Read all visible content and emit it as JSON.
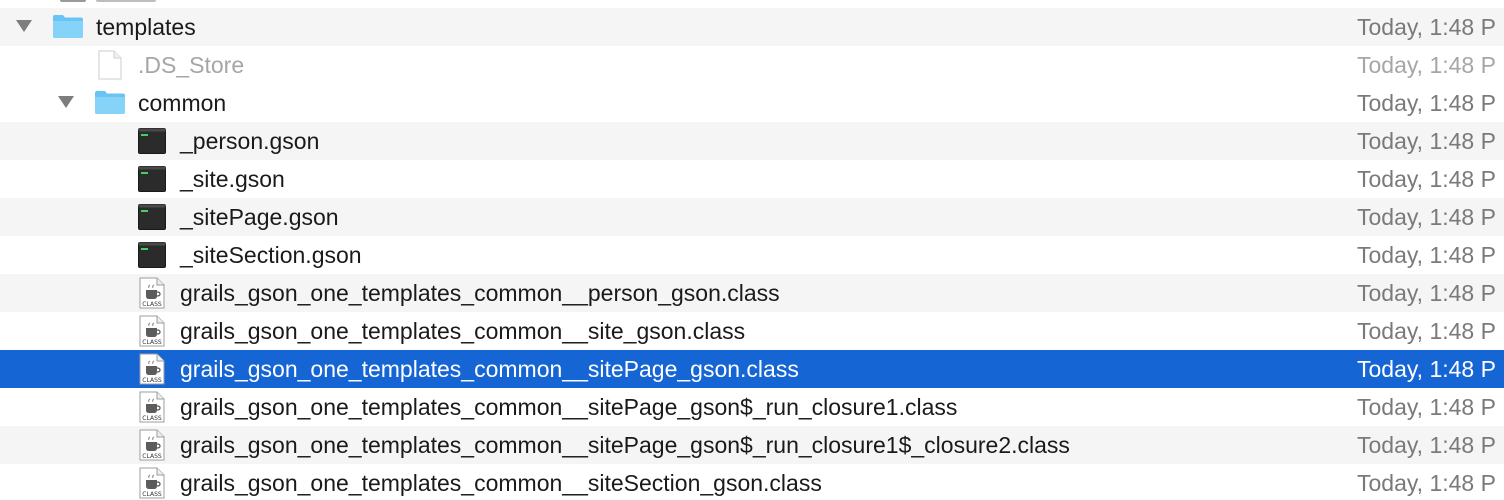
{
  "rows": [
    {
      "name": "templates",
      "date": "Today, 1:48 P",
      "kind": "folder",
      "expanded": true
    },
    {
      "name": ".DS_Store",
      "date": "Today, 1:48 P",
      "kind": "blank-file"
    },
    {
      "name": "common",
      "date": "Today, 1:48 P",
      "kind": "folder",
      "expanded": true
    },
    {
      "name": "_person.gson",
      "date": "Today, 1:48 P",
      "kind": "terminal-file"
    },
    {
      "name": "_site.gson",
      "date": "Today, 1:48 P",
      "kind": "terminal-file"
    },
    {
      "name": "_sitePage.gson",
      "date": "Today, 1:48 P",
      "kind": "terminal-file"
    },
    {
      "name": "_siteSection.gson",
      "date": "Today, 1:48 P",
      "kind": "terminal-file"
    },
    {
      "name": "grails_gson_one_templates_common__person_gson.class",
      "date": "Today, 1:48 P",
      "kind": "java-class-file"
    },
    {
      "name": "grails_gson_one_templates_common__site_gson.class",
      "date": "Today, 1:48 P",
      "kind": "java-class-file"
    },
    {
      "name": "grails_gson_one_templates_common__sitePage_gson.class",
      "date": "Today, 1:48 P",
      "kind": "java-class-file",
      "selected": true
    },
    {
      "name": "grails_gson_one_templates_common__sitePage_gson$_run_closure1.class",
      "date": "Today, 1:48 P",
      "kind": "java-class-file"
    },
    {
      "name": "grails_gson_one_templates_common__sitePage_gson$_run_closure1$_closure2.class",
      "date": "Today, 1:48 P",
      "kind": "java-class-file"
    },
    {
      "name": "grails_gson_one_templates_common__siteSection_gson.class",
      "date": "Today, 1:48 P",
      "kind": "java-class-file"
    }
  ],
  "icons": {
    "class_badge": "CLASS"
  },
  "colors": {
    "selection": "#1565d4",
    "folder": "#6cc6f5",
    "alt_row": "#f5f5f5"
  }
}
